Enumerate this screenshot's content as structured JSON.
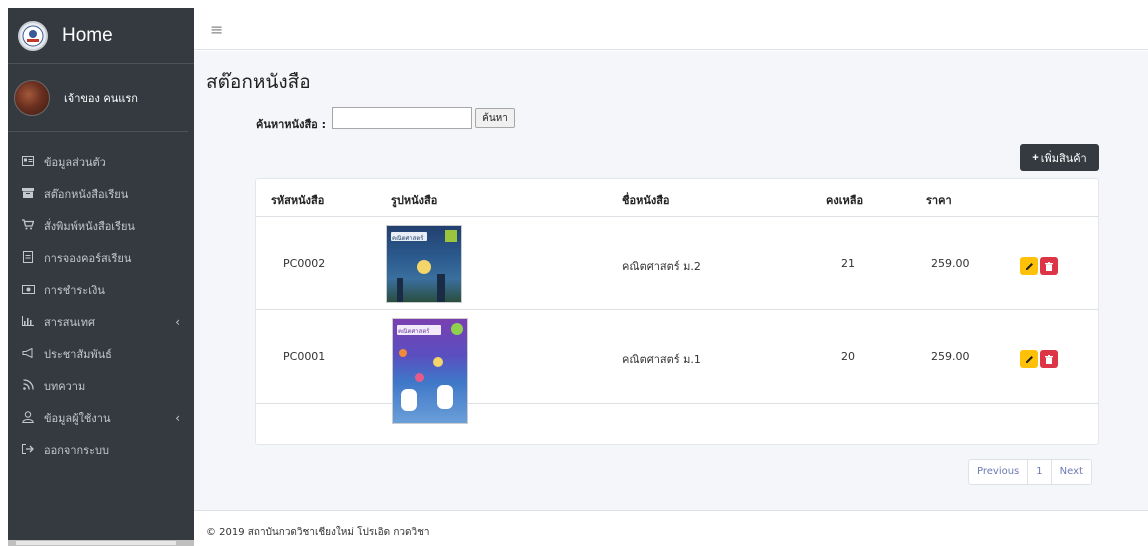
{
  "brand": {
    "title": "Home"
  },
  "user": {
    "name": "เจ้าของ คนแรก"
  },
  "sidebar": {
    "items": [
      {
        "label": "ข้อมูลส่วนตัว",
        "icon": "id-card-icon"
      },
      {
        "label": "สต๊อกหนังสือเรียน",
        "icon": "archive-icon"
      },
      {
        "label": "สั่งพิมพ์หนังสือเรียน",
        "icon": "cart-icon"
      },
      {
        "label": "การจองคอร์สเรียน",
        "icon": "document-icon"
      },
      {
        "label": "การชำระเงิน",
        "icon": "money-icon"
      },
      {
        "label": "สารสนเทศ",
        "icon": "chart-icon",
        "arrow": "‹"
      },
      {
        "label": "ประชาสัมพันธ์",
        "icon": "megaphone-icon"
      },
      {
        "label": "บทความ",
        "icon": "rss-icon"
      },
      {
        "label": "ข้อมูลผู้ใช้งาน",
        "icon": "user-icon",
        "arrow": "‹"
      },
      {
        "label": "ออกจากระบบ",
        "icon": "logout-icon"
      }
    ]
  },
  "page": {
    "title": "สต๊อกหนังสือ"
  },
  "search": {
    "label": "ค้นหาหนังสือ :",
    "value": "",
    "button": "ค้นหา"
  },
  "add_button": {
    "label": "เพิ่มสินค้า"
  },
  "table": {
    "headers": [
      "รหัสหนังสือ",
      "รูปหนังสือ",
      "ชื่อหนังสือ",
      "คงเหลือ",
      "ราคา"
    ],
    "rows": [
      {
        "code": "PC0002",
        "name": "คณิตศาสตร์ ม.2",
        "stock": "21",
        "price": "259.00",
        "cover_title": "คณิตศาสตร์",
        "cover_color": "#1f3f6b"
      },
      {
        "code": "PC0001",
        "name": "คณิตศาสตร์ ม.1",
        "stock": "20",
        "price": "259.00",
        "cover_title": "คณิตศาสตร์",
        "cover_color": "#6a3fa0"
      }
    ]
  },
  "pagination": {
    "previous": "Previous",
    "page": "1",
    "next": "Next"
  },
  "footer": {
    "text": "© 2019 สถาบันกวดวิชาเชียงใหม่ โปรเอิด กวดวิชา"
  },
  "colors": {
    "sidebar": "#343a40",
    "accent_edit": "#ffc107",
    "accent_delete": "#dc3545",
    "content_bg": "#f4f6f9"
  }
}
